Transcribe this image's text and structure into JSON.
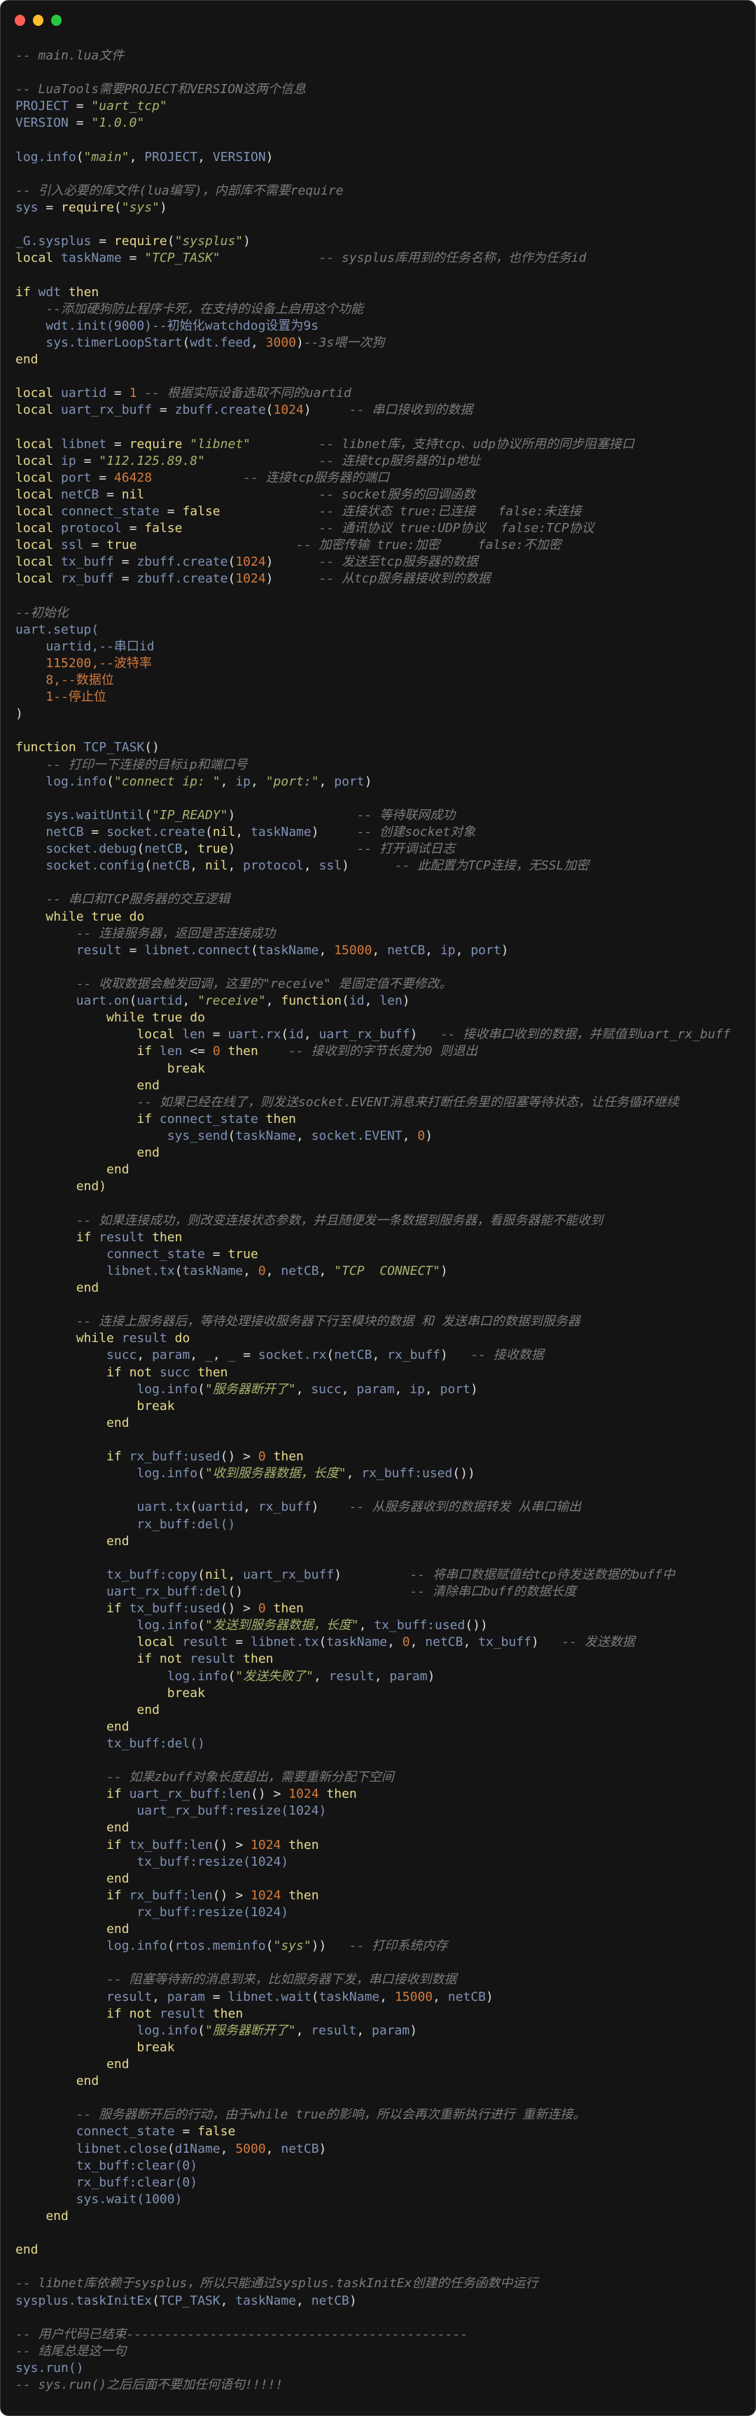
{
  "window": {
    "controls": [
      "close",
      "minimize",
      "maximize"
    ],
    "colors": {
      "background": "#141414",
      "close": "#ff5f57",
      "minimize": "#febc2e",
      "maximize": "#28c840"
    }
  },
  "syntax_colors": {
    "keyword": "#e6da8e",
    "identifier": "#7f92b6",
    "string": "#a9b16e",
    "number": "#d47b3c",
    "comment": "#7b7b7b"
  },
  "code": {
    "language": "lua",
    "lines": [
      "-- main.lua文件",
      "",
      "-- LuaTools需要PROJECT和VERSION这两个信息",
      "PROJECT = \"uart_tcp\"",
      "VERSION = \"1.0.0\"",
      "",
      "log.info(\"main\", PROJECT, VERSION)",
      "",
      "-- 引入必要的库文件(lua编写)，内部库不需要require",
      "sys = require(\"sys\")",
      "",
      "_G.sysplus = require(\"sysplus\")",
      "local taskName = \"TCP_TASK\"             -- sysplus库用到的任务名称，也作为任务id",
      "",
      "if wdt then",
      "    --添加硬狗防止程序卡死，在支持的设备上启用这个功能",
      "    wdt.init(9000)--初始化watchdog设置为9s",
      "    sys.timerLoopStart(wdt.feed, 3000)--3s喂一次狗",
      "end",
      "",
      "local uartid = 1 -- 根据实际设备选取不同的uartid",
      "local uart_rx_buff = zbuff.create(1024)     -- 串口接收到的数据",
      "",
      "local libnet = require \"libnet\"         -- libnet库，支持tcp、udp协议所用的同步阻塞接口",
      "local ip = \"112.125.89.8\"               -- 连接tcp服务器的ip地址",
      "local port = 46428            -- 连接tcp服务器的端口",
      "local netCB = nil                       -- socket服务的回调函数",
      "local connect_state = false             -- 连接状态 true:已连接   false:未连接",
      "local protocol = false                  -- 通讯协议 true:UDP协议  false:TCP协议",
      "local ssl = true                     -- 加密传输 true:加密     false:不加密",
      "local tx_buff = zbuff.create(1024)      -- 发送至tcp服务器的数据",
      "local rx_buff = zbuff.create(1024)      -- 从tcp服务器接收到的数据",
      "",
      "--初始化",
      "uart.setup(",
      "    uartid,--串口id",
      "    115200,--波特率",
      "    8,--数据位",
      "    1--停止位",
      ")",
      "",
      "function TCP_TASK()",
      "    -- 打印一下连接的目标ip和端口号",
      "    log.info(\"connect ip: \", ip, \"port:\", port)",
      "",
      "    sys.waitUntil(\"IP_READY\")                -- 等待联网成功",
      "    netCB = socket.create(nil, taskName)     -- 创建socket对象",
      "    socket.debug(netCB, true)                -- 打开调试日志",
      "    socket.config(netCB, nil, protocol, ssl)      -- 此配置为TCP连接，无SSL加密",
      "",
      "    -- 串口和TCP服务器的交互逻辑",
      "    while true do",
      "        -- 连接服务器，返回是否连接成功",
      "        result = libnet.connect(taskName, 15000, netCB, ip, port)",
      "",
      "        -- 收取数据会触发回调，这里的\"receive\" 是固定值不要修改。",
      "        uart.on(uartid, \"receive\", function(id, len)",
      "            while true do",
      "                local len = uart.rx(id, uart_rx_buff)   -- 接收串口收到的数据，并赋值到uart_rx_buff",
      "                if len <= 0 then    -- 接收到的字节长度为0 则退出",
      "                    break",
      "                end",
      "                -- 如果已经在线了，则发送socket.EVENT消息来打断任务里的阻塞等待状态，让任务循环继续",
      "                if connect_state then",
      "                    sys_send(taskName, socket.EVENT, 0)",
      "                end",
      "            end",
      "        end)",
      "",
      "        -- 如果连接成功，则改变连接状态参数，并且随便发一条数据到服务器，看服务器能不能收到",
      "        if result then",
      "            connect_state = true",
      "            libnet.tx(taskName, 0, netCB, \"TCP  CONNECT\")",
      "        end",
      "",
      "        -- 连接上服务器后，等待处理接收服务器下行至模块的数据 和 发送串口的数据到服务器",
      "        while result do",
      "            succ, param, _, _ = socket.rx(netCB, rx_buff)   -- 接收数据",
      "            if not succ then",
      "                log.info(\"服务器断开了\", succ, param, ip, port)",
      "                break",
      "            end",
      "",
      "            if rx_buff:used() > 0 then",
      "                log.info(\"收到服务器数据，长度\", rx_buff:used())",
      "",
      "                uart.tx(uartid, rx_buff)    -- 从服务器收到的数据转发 从串口输出",
      "                rx_buff:del()",
      "            end",
      "",
      "            tx_buff:copy(nil, uart_rx_buff)         -- 将串口数据赋值给tcp待发送数据的buff中",
      "            uart_rx_buff:del()                      -- 清除串口buff的数据长度",
      "            if tx_buff:used() > 0 then",
      "                log.info(\"发送到服务器数据，长度\", tx_buff:used())",
      "                local result = libnet.tx(taskName, 0, netCB, tx_buff)   -- 发送数据",
      "                if not result then",
      "                    log.info(\"发送失败了\", result, param)",
      "                    break",
      "                end",
      "            end",
      "            tx_buff:del()",
      "",
      "            -- 如果zbuff对象长度超出，需要重新分配下空间",
      "            if uart_rx_buff:len() > 1024 then",
      "                uart_rx_buff:resize(1024)",
      "            end",
      "            if tx_buff:len() > 1024 then",
      "                tx_buff:resize(1024)",
      "            end",
      "            if rx_buff:len() > 1024 then",
      "                rx_buff:resize(1024)",
      "            end",
      "            log.info(rtos.meminfo(\"sys\"))   -- 打印系统内存",
      "",
      "            -- 阻塞等待新的消息到来，比如服务器下发，串口接收到数据",
      "            result, param = libnet.wait(taskName, 15000, netCB)",
      "            if not result then",
      "                log.info(\"服务器断开了\", result, param)",
      "                break",
      "            end",
      "        end",
      "",
      "        -- 服务器断开后的行动，由于while true的影响，所以会再次重新执行进行 重新连接。",
      "        connect_state = false",
      "        libnet.close(d1Name, 5000, netCB)",
      "        tx_buff:clear(0)",
      "        rx_buff:clear(0)",
      "        sys.wait(1000)",
      "    end",
      "",
      "end",
      "",
      "-- libnet库依赖于sysplus，所以只能通过sysplus.taskInitEx创建的任务函数中运行",
      "sysplus.taskInitEx(TCP_TASK, taskName, netCB)",
      "",
      "-- 用户代码已结束---------------------------------------------",
      "-- 结尾总是这一句",
      "sys.run()",
      "-- sys.run()之后后面不要加任何语句!!!!!"
    ]
  }
}
